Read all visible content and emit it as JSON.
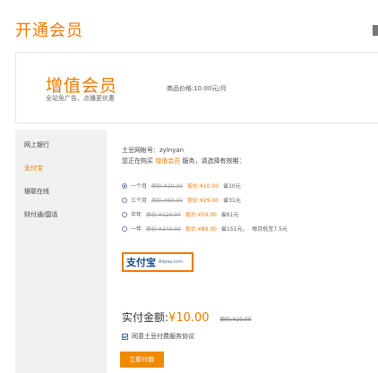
{
  "page": {
    "title": "开通会员"
  },
  "product": {
    "name": "增值会员",
    "subtitle": "全站免广告，点播更优惠",
    "price": "商品价格:10.00元/月"
  },
  "sidebar": {
    "items": [
      {
        "label": "网上银行",
        "active": false
      },
      {
        "label": "支付宝",
        "active": true
      },
      {
        "label": "银联在线",
        "active": false
      },
      {
        "label": "财付通/国话",
        "active": false
      }
    ]
  },
  "main": {
    "account_label": "土豆网帐号：zylnyan",
    "intro_prefix": "您正在购买",
    "intro_highlight": "增值会员",
    "intro_suffix": "服务，请选择有效期：",
    "options": [
      {
        "period": "一个月",
        "original": "原价:¥20.00",
        "now": "现价:¥10.00",
        "save": "省10元",
        "extra": "",
        "selected": true
      },
      {
        "period": "三个月",
        "original": "原价:¥60.00",
        "now": "现价:¥29.00",
        "save": "省31元",
        "extra": "",
        "selected": false
      },
      {
        "period": "半年",
        "original": "原价:¥120.00",
        "now": "现价:¥59.00",
        "save": "省61元",
        "extra": "",
        "selected": false
      },
      {
        "period": "一年",
        "original": "原价:¥240.00",
        "now": "现价:¥89.00",
        "save": "省151元，",
        "extra": "每月低至7.5元",
        "selected": false
      }
    ],
    "alipay_logo": "支付宝",
    "alipay_en": "Alipay.com",
    "pay_label": "实付金额:",
    "pay_amount": "¥10.00",
    "pay_original": "原价:¥20.00",
    "agreement": "同意土豆付费服务协议",
    "pay_button": "立即付款"
  }
}
